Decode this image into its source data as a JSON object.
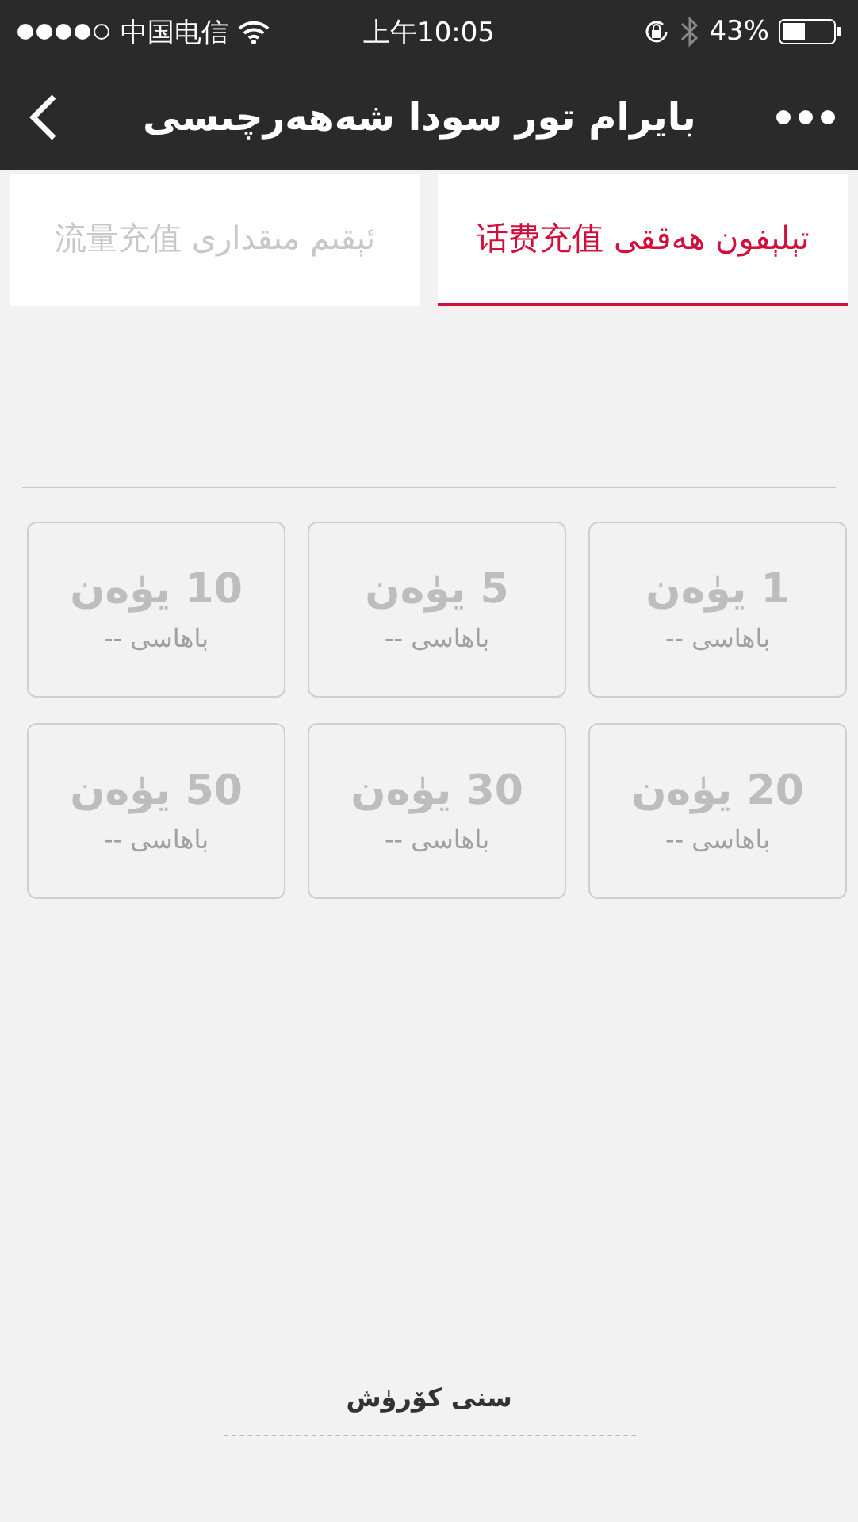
{
  "status_bar": {
    "carrier": "中国电信",
    "time": "上午10:05",
    "battery": "43%"
  },
  "nav": {
    "title": "بايرام تور سودا شەھەرچىسى"
  },
  "tabs": [
    {
      "label": "تېلېفون ھەققى 话费充值",
      "selected": true
    },
    {
      "label": "ئېقىم مىقدارى 流量充值",
      "selected": false
    }
  ],
  "packages": [
    {
      "amount": "1 يۈەن",
      "price": "باھاسى --"
    },
    {
      "amount": "5 يۈەن",
      "price": "باھاسى --"
    },
    {
      "amount": "10 يۈەن",
      "price": "باھاسى --"
    },
    {
      "amount": "20 يۈەن",
      "price": "باھاسى --"
    },
    {
      "amount": "30 يۈەن",
      "price": "باھاسى --"
    },
    {
      "amount": "50 يۈەن",
      "price": "باھاسى --"
    }
  ],
  "footer": {
    "link": "سنى كۆرۈش"
  }
}
